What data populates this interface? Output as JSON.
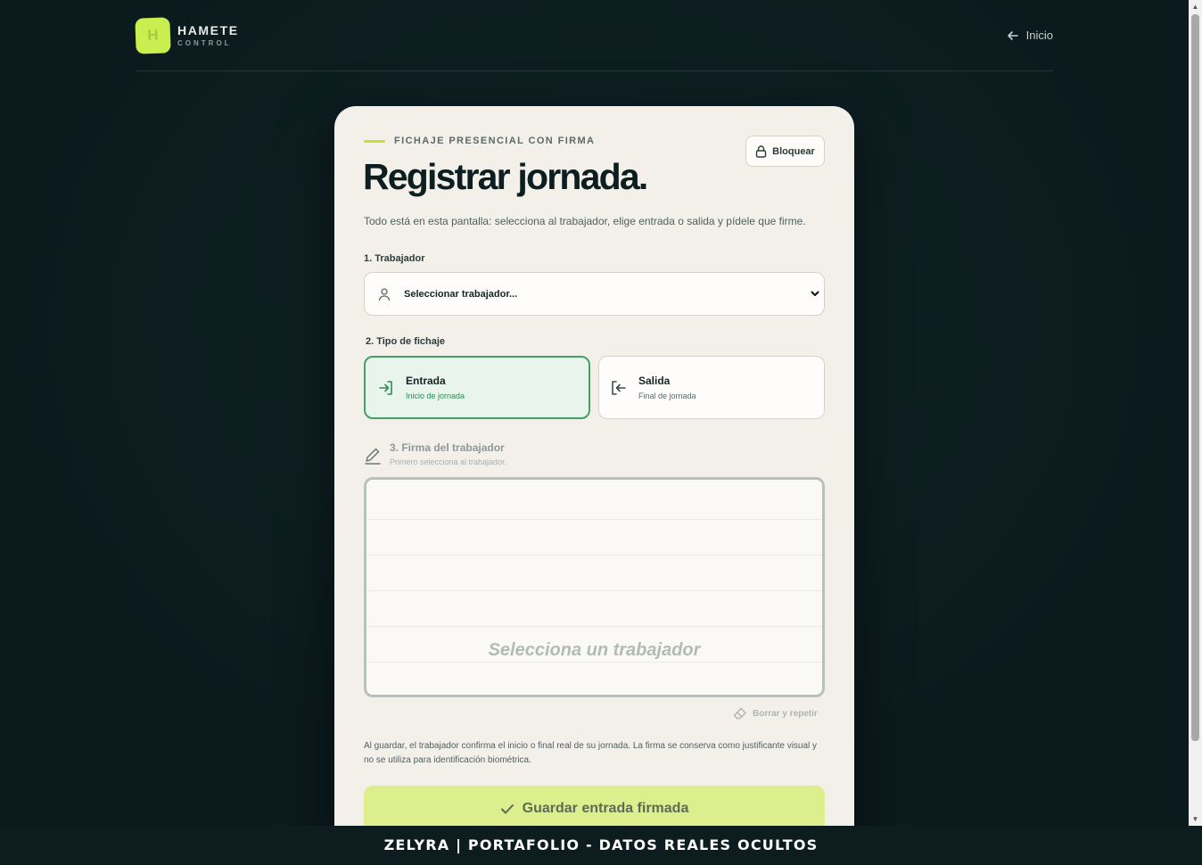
{
  "brand": {
    "logo_letter": "H",
    "name": "HAMETE",
    "sub": "CONTROL",
    "accent": "#c9ee4f"
  },
  "nav": {
    "home_label": "Inicio"
  },
  "card": {
    "eyebrow": "FICHAJE PRESENCIAL CON FIRMA",
    "lock_label": "Bloquear",
    "title": "Registrar jornada.",
    "description": "Todo está en esta pantalla: selecciona al trabajador, elige entrada o salida y pídele que firme.",
    "worker": {
      "label": "1. Trabajador",
      "selected": "Seleccionar trabajador..."
    },
    "type": {
      "label": "2. Tipo de fichaje",
      "options": [
        {
          "title": "Entrada",
          "subtitle": "Inicio de jornada",
          "selected": true
        },
        {
          "title": "Salida",
          "subtitle": "Final de jornada",
          "selected": false
        }
      ]
    },
    "signature": {
      "label": "3. Firma del trabajador",
      "hint": "Primero selecciona al trabajador.",
      "placeholder": "Selecciona un trabajador",
      "erase_label": "Borrar y repetir"
    },
    "note": "Al guardar, el trabajador confirma el inicio o final real de su jornada. La firma se conserva como justificante visual y no se utiliza para identificación biométrica.",
    "save_label": "Guardar entrada firmada"
  },
  "banner": "ZELYRA | PORTAFOLIO - DATOS REALES OCULTOS",
  "icons": [
    "logo-icon",
    "arrow-left-icon",
    "lock-icon",
    "user-icon",
    "chevron-down-icon",
    "login-icon",
    "logout-icon",
    "pen-icon",
    "eraser-icon",
    "check-icon"
  ]
}
